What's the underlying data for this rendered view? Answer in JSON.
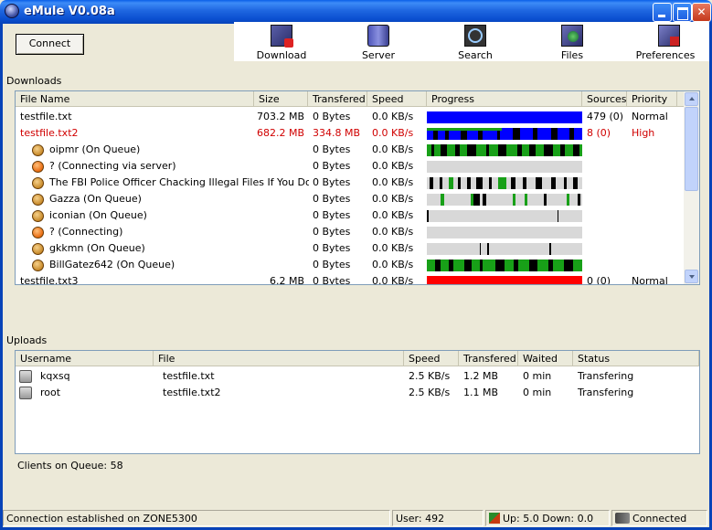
{
  "window": {
    "title": "eMule V0.08a"
  },
  "toolbar": {
    "connect_label": "Connect",
    "items": [
      {
        "label": "Download",
        "icon": "download-icon"
      },
      {
        "label": "Server",
        "icon": "server-icon"
      },
      {
        "label": "Search",
        "icon": "search-icon"
      },
      {
        "label": "Files",
        "icon": "files-icon"
      },
      {
        "label": "Preferences",
        "icon": "preferences-icon"
      }
    ]
  },
  "downloads": {
    "label": "Downloads",
    "columns": [
      "File Name",
      "Size",
      "Transfered",
      "Speed",
      "Progress",
      "Sources",
      "Priority"
    ],
    "rows": [
      {
        "kind": "file",
        "name": "testfile.txt",
        "size": "703.2 MB",
        "transfered": "0 Bytes",
        "speed": "0.0 KB/s",
        "sources": "479 (0)",
        "priority": "Normal",
        "highlight": false
      },
      {
        "kind": "file",
        "name": "testfile.txt2",
        "size": "682.2 MB",
        "transfered": "334.8 MB",
        "speed": "0.0 KB/s",
        "sources": "8 (0)",
        "priority": "High",
        "highlight": true
      },
      {
        "kind": "source",
        "name": "oipmr  (On Queue)",
        "transfered": "0 Bytes",
        "speed": "0.0 KB/s",
        "state": "queue"
      },
      {
        "kind": "source",
        "name": "?  (Connecting via server)",
        "transfered": "0 Bytes",
        "speed": "0.0 KB/s",
        "state": "connecting"
      },
      {
        "kind": "source",
        "name": "The FBI Police Officer Chacking Illegal Files If You Don't Wa",
        "transfered": "0 Bytes",
        "speed": "0.0 KB/s",
        "state": "queue"
      },
      {
        "kind": "source",
        "name": "Gazza  (On Queue)",
        "transfered": "0 Bytes",
        "speed": "0.0 KB/s",
        "state": "queue"
      },
      {
        "kind": "source",
        "name": "iconian  (On Queue)",
        "transfered": "0 Bytes",
        "speed": "0.0 KB/s",
        "state": "queue"
      },
      {
        "kind": "source",
        "name": "?  (Connecting)",
        "transfered": "0 Bytes",
        "speed": "0.0 KB/s",
        "state": "connecting"
      },
      {
        "kind": "source",
        "name": "gkkmn  (On Queue)",
        "transfered": "0 Bytes",
        "speed": "0.0 KB/s",
        "state": "queue"
      },
      {
        "kind": "source",
        "name": "BillGatez642  (On Queue)",
        "transfered": "0 Bytes",
        "speed": "0.0 KB/s",
        "state": "queue"
      },
      {
        "kind": "file",
        "name": "testfile.txt3",
        "size": "6.2 MB",
        "transfered": "0 Bytes",
        "speed": "0.0 KB/s",
        "sources": "0 (0)",
        "priority": "Normal",
        "highlight": false
      }
    ]
  },
  "uploads": {
    "label": "Uploads",
    "columns": [
      "Username",
      "File",
      "Speed",
      "Transfered",
      "Waited",
      "Status"
    ],
    "rows": [
      {
        "username": "kqxsq",
        "file": "testfile.txt",
        "speed": "2.5 KB/s",
        "transfered": "1.2 MB",
        "waited": "0 min",
        "status": "Transfering"
      },
      {
        "username": "root",
        "file": "testfile.txt2",
        "speed": "2.5 KB/s",
        "transfered": "1.1 MB",
        "waited": "0 min",
        "status": "Transfering"
      }
    ]
  },
  "queue": {
    "clients_on_queue": "Clients on Queue: 58"
  },
  "status": {
    "connection": "Connection established on ZONE5300",
    "users": "User: 492",
    "updown": "Up: 5.0  Down: 0.0",
    "state": "Connected"
  },
  "colors": {
    "progress_blue": "#0000ff",
    "progress_red": "#ff0000",
    "chunk_green": "#18a018",
    "chunk_black": "#000000",
    "chunk_gray": "#d8d8d8",
    "highlight_red": "#d00000"
  }
}
